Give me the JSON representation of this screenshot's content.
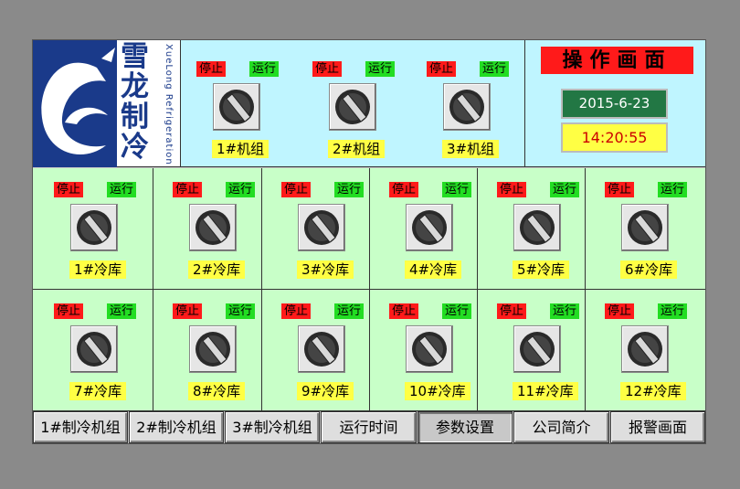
{
  "screen": {
    "title": "操作画面",
    "date": "2015-6-23",
    "time": "14:20:55",
    "stop_label": "停止",
    "run_label": "运行"
  },
  "logo": {
    "name_zh": "雪龙制冷",
    "name_en": "XueLong Refrigeration"
  },
  "units": [
    {
      "label": "1#机组"
    },
    {
      "label": "2#机组"
    },
    {
      "label": "3#机组"
    }
  ],
  "rooms": [
    {
      "label": "1#冷库"
    },
    {
      "label": "2#冷库"
    },
    {
      "label": "3#冷库"
    },
    {
      "label": "4#冷库"
    },
    {
      "label": "5#冷库"
    },
    {
      "label": "6#冷库"
    },
    {
      "label": "7#冷库"
    },
    {
      "label": "8#冷库"
    },
    {
      "label": "9#冷库"
    },
    {
      "label": "10#冷库"
    },
    {
      "label": "11#冷库"
    },
    {
      "label": "12#冷库"
    }
  ],
  "nav": [
    {
      "label": "1#制冷机组"
    },
    {
      "label": "2#制冷机组"
    },
    {
      "label": "3#制冷机组"
    },
    {
      "label": "运行时间"
    },
    {
      "label": "参数设置",
      "active": true
    },
    {
      "label": "公司简介"
    },
    {
      "label": "报警画面"
    }
  ],
  "colors": {
    "stop": "#ff1a1a",
    "run": "#22dd22",
    "top_bg": "#bff5ff",
    "cell_bg": "#c8ffc8",
    "label_bg": "#ffff44",
    "date_bg": "#227744",
    "time_fg": "#cc0000",
    "logo_blue": "#1a3a8a"
  },
  "icons": {
    "switch": "rotary-switch-icon",
    "logo": "dragon-logo-icon"
  }
}
